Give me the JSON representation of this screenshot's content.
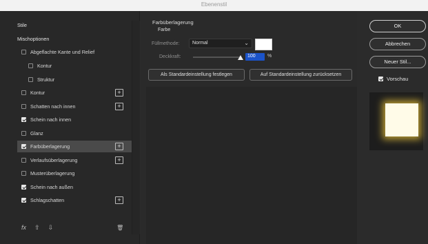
{
  "window": {
    "title": "Ebenenstil"
  },
  "sidebar": {
    "items": [
      {
        "label": "Stile",
        "type": "header",
        "checked": null,
        "plus": false
      },
      {
        "label": "Mischoptionen",
        "type": "header",
        "checked": null,
        "plus": false
      },
      {
        "label": "Abgeflachte Kante und Relief",
        "type": "effect",
        "checked": false,
        "plus": false
      },
      {
        "label": "Kontur",
        "type": "sub",
        "checked": false,
        "plus": false
      },
      {
        "label": "Struktur",
        "type": "sub",
        "checked": false,
        "plus": false
      },
      {
        "label": "Kontur",
        "type": "effect",
        "checked": false,
        "plus": true
      },
      {
        "label": "Schatten nach innen",
        "type": "effect",
        "checked": false,
        "plus": true
      },
      {
        "label": "Schein nach innen",
        "type": "effect",
        "checked": true,
        "plus": false
      },
      {
        "label": "Glanz",
        "type": "effect",
        "checked": false,
        "plus": false
      },
      {
        "label": "Farbüberlagerung",
        "type": "effect",
        "checked": true,
        "plus": true,
        "selected": true
      },
      {
        "label": "Verlaufsüberlagerung",
        "type": "effect",
        "checked": false,
        "plus": true
      },
      {
        "label": "Musterüberlagerung",
        "type": "effect",
        "checked": false,
        "plus": false
      },
      {
        "label": "Schein nach außen",
        "type": "effect",
        "checked": true,
        "plus": false
      },
      {
        "label": "Schlagschatten",
        "type": "effect",
        "checked": true,
        "plus": true
      }
    ],
    "footer": {
      "fx": "fx",
      "up": "⇧",
      "down": "⇩",
      "trash": "🗑"
    }
  },
  "panel": {
    "section_title": "Farbüberlagerung",
    "group_title": "Farbe",
    "blend_mode_label": "Füllmethode:",
    "blend_mode_value": "Normal",
    "opacity_label": "Deckkraft:",
    "opacity_value": "100",
    "opacity_unit": "%",
    "swatch_color": "#ffffff",
    "set_default_label": "Als Standardeinstellung festlegen",
    "reset_default_label": "Auf Standardeinstellung zurücksetzen"
  },
  "actions": {
    "ok_label": "OK",
    "cancel_label": "Abbrechen",
    "new_style_label": "Neuer Stil...",
    "preview_label": "Vorschau",
    "preview_checked": true
  },
  "colors": {
    "accent": "#1b53c9",
    "glow": "#f0c83c"
  }
}
